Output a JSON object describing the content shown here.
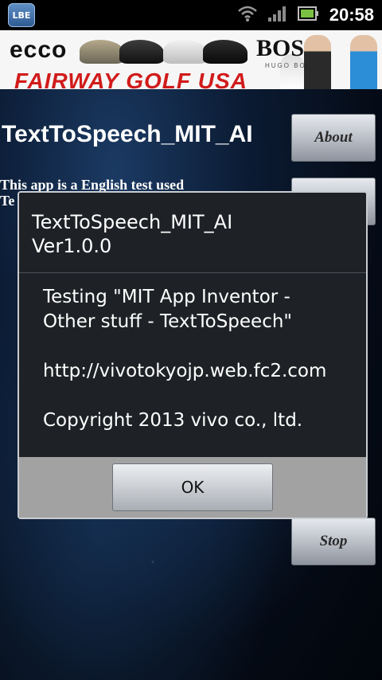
{
  "status_bar": {
    "app_icon_text": "LBE",
    "time": "20:58"
  },
  "ad": {
    "brand_left": "ecco",
    "brand_right": "BOSS",
    "brand_right_sub": "HUGO BOSS",
    "headline": "FAIRWAY GOLF USA"
  },
  "app": {
    "title": "TextToSpeech_MIT_AI",
    "description_line1": "This app is a English test used",
    "description_line2": "Te",
    "about_label": "About",
    "stop_label": "Stop"
  },
  "dialog": {
    "title_line1": "TextToSpeech_MIT_AI",
    "title_line2": "Ver1.0.0",
    "message_line1": "Testing \"MIT App Inventor -",
    "message_line2": "Other stuff - TextToSpeech\"",
    "message_line3": "http://vivotokyojp.web.fc2.com",
    "message_line4": "Copyright 2013 vivo co., ltd.",
    "ok_label": "OK"
  },
  "icons": {
    "status": [
      "lbe-app-icon",
      "wifi-icon",
      "signal-icon",
      "battery-icon"
    ]
  }
}
